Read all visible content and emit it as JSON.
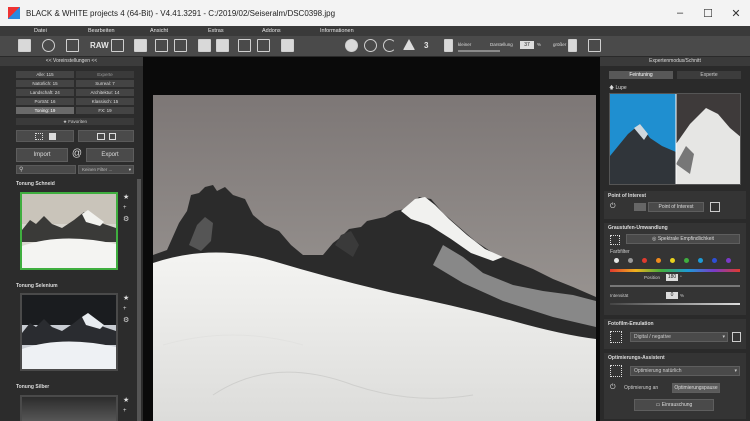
{
  "window": {
    "title": "BLACK & WHITE projects 4 (64-Bit) - V4.41.3291 - C:/2019/02/Seiseralm/DSC0398.jpg",
    "minimize": "–",
    "maximize": "☐",
    "close": "✕"
  },
  "menu": [
    "Datei",
    "Bearbeiten",
    "Ansicht",
    "Extras",
    "Addons",
    "Informationen"
  ],
  "toolbar": {
    "raw_label": "RAW",
    "strength_left": "kleiner",
    "strength_mid": "Darstellung",
    "strength_value": "37",
    "strength_unit": "%",
    "strength_right": "größer"
  },
  "left_panel": {
    "header": "<< Voreinstellungen <<",
    "categories": [
      {
        "label": "Alle: 115",
        "state": "normal"
      },
      {
        "label": "Experte",
        "state": "dim"
      },
      {
        "label": "Natürlich: 15",
        "state": "normal"
      },
      {
        "label": "Surreal: 7",
        "state": "normal"
      },
      {
        "label": "Landschaft: 24",
        "state": "normal"
      },
      {
        "label": "Architektur: 14",
        "state": "normal"
      },
      {
        "label": "Porträt: 16",
        "state": "normal"
      },
      {
        "label": "Klassisch: 15",
        "state": "normal"
      },
      {
        "label": "Toning: 19",
        "state": "active"
      },
      {
        "label": "FX: 19",
        "state": "normal"
      }
    ],
    "favorites": "Favoriten",
    "import_label": "Import",
    "export_label": "Export",
    "filter_placeholder": "Keinen Filter ...",
    "presets": [
      "Tonung Schneid",
      "Tonung Selenium",
      "Tonung Silber"
    ]
  },
  "right_panel": {
    "header": "Expertenmodus/Schnitt",
    "tab_finetuning": "Feintuning",
    "tab_expert": "Experte",
    "loupe_label": "Lupe",
    "poi_title": "Point of Interest",
    "poi_button": "Point of Interest",
    "gray_title": "Graustufen-Umwandlung",
    "gray_spectral": "Spektrale Empfindlichkeit",
    "farbfilter": "Farbfilter",
    "filter_swatches": [
      "#e6e6e6",
      "#9a9a9a",
      "#e03a2e",
      "#f08a1e",
      "#e8d21e",
      "#3fae3f",
      "#1e9ad6",
      "#2d4fd6",
      "#7a3ac8"
    ],
    "position_label": "Position",
    "position_value": "180",
    "position_unit": "°",
    "intensity_label": "Intensität",
    "intensity_value": "0",
    "intensity_unit": "%",
    "film_title": "Fotofilm-Emulation",
    "film_select": "Digital / negative",
    "opt_title": "Optimierungs-Assistent",
    "opt_select": "Optimierung natürlich",
    "opt_on": "Optimierung an",
    "opt_pause": "Optimierungspause",
    "opt_apply": "Einrauschung"
  }
}
